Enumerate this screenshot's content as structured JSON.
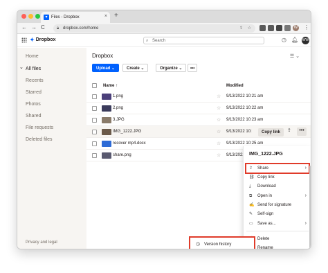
{
  "browser": {
    "tab_title": "Files - Dropbox",
    "tab_close": "×",
    "new_tab": "+",
    "back": "←",
    "forward": "→",
    "reload": "C",
    "url": "dropbox.com/home",
    "profile_initial": "W"
  },
  "header": {
    "logo_text": "Dropbox",
    "search_placeholder": "Search",
    "user_initials": "WW"
  },
  "sidebar": {
    "items": [
      {
        "label": "Home"
      },
      {
        "label": "All files"
      },
      {
        "label": "Recents"
      },
      {
        "label": "Starred"
      },
      {
        "label": "Photos"
      },
      {
        "label": "Shared"
      },
      {
        "label": "File requests"
      },
      {
        "label": "Deleted files"
      }
    ],
    "footer": "Privacy and legal"
  },
  "main": {
    "breadcrumb": "Dropbox",
    "buttons": {
      "upload": "Upload ⌄",
      "create": "Create ⌄",
      "organize": "Organize ⌄",
      "more": "•••"
    },
    "columns": {
      "name": "Name ↑",
      "modified": "Modified"
    },
    "files": [
      {
        "name": "1.png",
        "modified": "9/13/2022 10:21 am",
        "thumb": "#4b3f7a"
      },
      {
        "name": "2.png",
        "modified": "9/13/2022 10:22 am",
        "thumb": "#3b3b5b"
      },
      {
        "name": "3.JPG",
        "modified": "9/13/2022 10:23 am",
        "thumb": "#8a7b6a"
      },
      {
        "name": "IMG_1222.JPG",
        "modified": "9/13/2022 10:",
        "thumb": "#6b5a4a"
      },
      {
        "name": "recover mp4.docx",
        "modified": "9/13/2022 10:25 am",
        "thumb": "#2d6bd6"
      },
      {
        "name": "share.png",
        "modified": "9/13/2022 10:26 am",
        "thumb": "#5a5a70"
      }
    ],
    "copy_link": "Copy link"
  },
  "context_menu": {
    "title": "IMG_1222.JPG",
    "items": [
      {
        "label": "Share",
        "icon": "share-icon",
        "chevron": true
      },
      {
        "label": "Copy link",
        "icon": "link-icon"
      },
      {
        "label": "Download",
        "icon": "download-icon"
      },
      {
        "label": "Open in",
        "icon": "open-in-icon",
        "chevron": true
      },
      {
        "label": "Send for signature",
        "icon": "signature-icon"
      },
      {
        "label": "Self-sign",
        "icon": "self-sign-icon"
      },
      {
        "label": "Save as...",
        "icon": "save-as-icon",
        "chevron": true
      },
      {
        "label": "Delete",
        "icon": "trash-icon"
      },
      {
        "label": "Rename",
        "icon": "rename-icon"
      }
    ],
    "version_history": "Version history"
  },
  "colors": {
    "accent": "#0061fe",
    "highlight": "#e03b2a"
  }
}
